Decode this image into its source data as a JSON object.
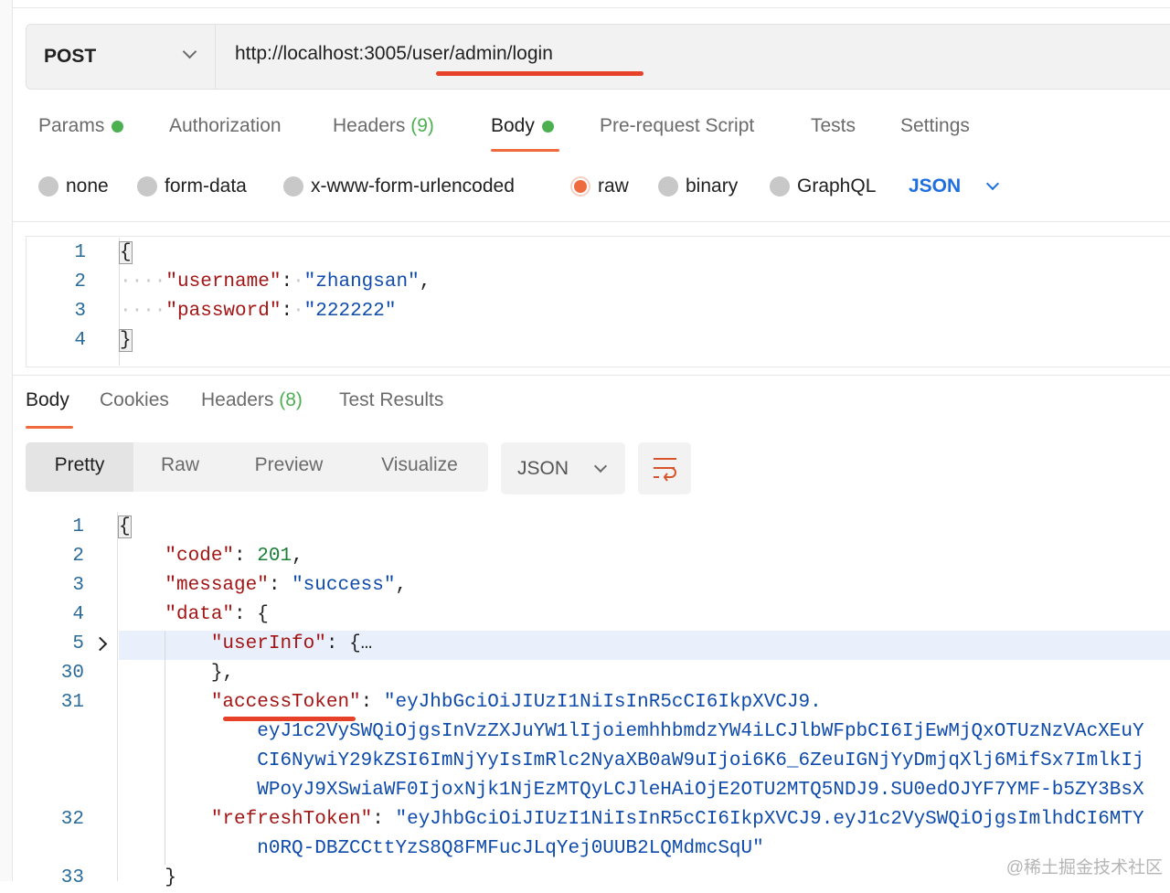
{
  "request": {
    "method": "POST",
    "url": "http://localhost:3005/user/admin/login",
    "tabs": [
      {
        "label": "Params",
        "dot": true
      },
      {
        "label": "Authorization"
      },
      {
        "label": "Headers",
        "count": "(9)"
      },
      {
        "label": "Body",
        "dot": true,
        "active": true
      },
      {
        "label": "Pre-request Script"
      },
      {
        "label": "Tests"
      },
      {
        "label": "Settings"
      }
    ],
    "body_types": [
      "none",
      "form-data",
      "x-www-form-urlencoded",
      "raw",
      "binary",
      "GraphQL"
    ],
    "selected_body_type": "raw",
    "format": "JSON",
    "code_lines": [
      {
        "num": "1",
        "parts": [
          {
            "t": "{",
            "c": "brk"
          }
        ]
      },
      {
        "num": "2",
        "parts": [
          {
            "t": "····",
            "c": "d"
          },
          {
            "t": "\"username\"",
            "c": "k"
          },
          {
            "t": ":",
            "c": "p"
          },
          {
            "t": "·",
            "c": "d"
          },
          {
            "t": "\"zhangsan\"",
            "c": "s"
          },
          {
            "t": ",",
            "c": "p"
          }
        ]
      },
      {
        "num": "3",
        "parts": [
          {
            "t": "····",
            "c": "d"
          },
          {
            "t": "\"password\"",
            "c": "k"
          },
          {
            "t": ":",
            "c": "p"
          },
          {
            "t": "·",
            "c": "d"
          },
          {
            "t": "\"222222\"",
            "c": "s"
          }
        ]
      },
      {
        "num": "4",
        "parts": [
          {
            "t": "}",
            "c": "brk"
          }
        ]
      }
    ]
  },
  "response": {
    "tabs": [
      {
        "label": "Body",
        "active": true
      },
      {
        "label": "Cookies"
      },
      {
        "label": "Headers",
        "count": "(8)"
      },
      {
        "label": "Test Results"
      }
    ],
    "views": [
      "Pretty",
      "Raw",
      "Preview",
      "Visualize"
    ],
    "active_view": "Pretty",
    "format": "JSON",
    "wrap_icon": "wrap-lines-icon",
    "code_lines": [
      {
        "num": "1",
        "parts": [
          {
            "t": "{",
            "c": "brk"
          }
        ]
      },
      {
        "num": "2",
        "parts": [
          {
            "t": "    "
          },
          {
            "t": "\"code\"",
            "c": "k"
          },
          {
            "t": ": ",
            "c": "p"
          },
          {
            "t": "201",
            "c": "n"
          },
          {
            "t": ",",
            "c": "p"
          }
        ]
      },
      {
        "num": "3",
        "parts": [
          {
            "t": "    "
          },
          {
            "t": "\"message\"",
            "c": "k"
          },
          {
            "t": ": ",
            "c": "p"
          },
          {
            "t": "\"success\"",
            "c": "s"
          },
          {
            "t": ",",
            "c": "p"
          }
        ]
      },
      {
        "num": "4",
        "parts": [
          {
            "t": "    "
          },
          {
            "t": "\"data\"",
            "c": "k"
          },
          {
            "t": ": {",
            "c": "p"
          }
        ]
      },
      {
        "num": "5",
        "fold": true,
        "parts": [
          {
            "t": "        "
          },
          {
            "t": "\"userInfo\"",
            "c": "k"
          },
          {
            "t": ": {",
            "c": "p"
          },
          {
            "t": "…",
            "c": "p"
          }
        ]
      },
      {
        "num": "30",
        "parts": [
          {
            "t": "        "
          },
          {
            "t": "},",
            "c": "p"
          }
        ]
      },
      {
        "num": "31",
        "parts": [
          {
            "t": "        "
          },
          {
            "t": "\"accessToken\"",
            "c": "k"
          },
          {
            "t": ": ",
            "c": "p"
          },
          {
            "t": "\"eyJhbGciOiJIUzI1NiIsInR5cCI6IkpXVCJ9.",
            "c": "s"
          }
        ]
      },
      {
        "num": "",
        "parts": [
          {
            "t": "            "
          },
          {
            "t": "eyJ1c2VySWQiOjgsInVzZXJuYW1lIjoiemhhbmdzYW4iLCJlbWFpbCI6IjEwMjQxOTUzNzVAcXEuY",
            "c": "s"
          }
        ]
      },
      {
        "num": "",
        "parts": [
          {
            "t": "            "
          },
          {
            "t": "CI6NywiY29kZSI6ImNjYyIsImRlc2NyaXB0aW9uIjoi6K6_6ZeuIGNjYyDmjqXlj6MifSx7ImlkIj",
            "c": "s"
          }
        ]
      },
      {
        "num": "",
        "parts": [
          {
            "t": "            "
          },
          {
            "t": "WPoyJ9XSwiaWF0IjoxNjk1NjEzMTQyLCJleHAiOjE2OTU2MTQ5NDJ9.SU0edOJYF7YMF-b5ZY3BsX",
            "c": "s"
          }
        ]
      },
      {
        "num": "32",
        "parts": [
          {
            "t": "        "
          },
          {
            "t": "\"refreshToken\"",
            "c": "k"
          },
          {
            "t": ": ",
            "c": "p"
          },
          {
            "t": "\"eyJhbGciOiJIUzI1NiIsInR5cCI6IkpXVCJ9.eyJ1c2VySWQiOjgsImlhdCI6MTY",
            "c": "s"
          }
        ]
      },
      {
        "num": "",
        "parts": [
          {
            "t": "            "
          },
          {
            "t": "n0RQ-DBZCCttYzS8Q8FMFucJLqYej0UUB2LQMdmcSqU\"",
            "c": "s"
          }
        ]
      },
      {
        "num": "33",
        "parts": [
          {
            "t": "    "
          },
          {
            "t": "}",
            "c": "p"
          }
        ]
      }
    ]
  },
  "watermark": "@稀土掘金技术社区",
  "colors": {
    "accent": "#ef6a3c",
    "underline": "#e8412a",
    "green": "#4caf50",
    "key": "#a31515",
    "string": "#0f4bab"
  }
}
